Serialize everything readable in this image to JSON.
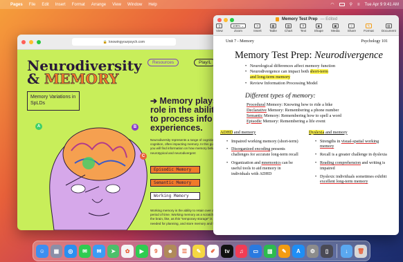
{
  "menubar": {
    "apple": "",
    "app_name": "Pages",
    "items": [
      "File",
      "Edit",
      "Insert",
      "Format",
      "Arrange",
      "View",
      "Window",
      "Help"
    ],
    "clock": "Tue Apr 9  9:41 AM"
  },
  "safari": {
    "url": "knowingyourpsych.com",
    "title_line1": "Neurodiversity",
    "title_line2_prefix": "& ",
    "title_line2": "MEMORY",
    "tab_resources": "Resources",
    "tab_play": "Play/L",
    "card_text": "Memory Variations in SpLDs",
    "headline": "Memory plays a role in the ability to process info experiences.",
    "arrow": "➔",
    "body_text": "Neurodiversity represents a range of cognitive and cognition, often impacting memory. In this guide, you will find information on how memory between neurotypical and neurodivergent",
    "buttons": [
      "Episodic Memory",
      "Semantic Memory",
      "Working Memory"
    ],
    "body_text2": "Working memory is the ability to retain over a short period of time. Working memory as a scratchpad for the brain, like, as this \"temporary storage\" is needed for planning, and store memory and focus.",
    "badges": [
      "A",
      "B",
      "C"
    ]
  },
  "pages": {
    "doc_title": "Memory Test Prep",
    "edited": "— Edited",
    "toolbar": [
      {
        "label": "View",
        "icon": "sidebar-icon"
      },
      {
        "label": "Zoom",
        "icon": "zoom-icon",
        "value": "106%"
      },
      {
        "label": "Insert",
        "icon": "plus-icon"
      },
      {
        "label": "Table",
        "icon": "table-icon"
      },
      {
        "label": "Chart",
        "icon": "chart-icon"
      },
      {
        "label": "Text",
        "icon": "text-icon"
      },
      {
        "label": "Shape",
        "icon": "shape-icon"
      },
      {
        "label": "Media",
        "icon": "media-icon"
      },
      {
        "label": "Share",
        "icon": "share-icon"
      },
      {
        "label": "Format",
        "icon": "format-icon"
      },
      {
        "label": "Document",
        "icon": "document-icon"
      }
    ],
    "header_left": "Unit 7 - Memory",
    "header_right": "Psychology 101",
    "heading_plain": "Memory Test Prep: ",
    "heading_italic": "Neurodivergence",
    "bullets": {
      "b1": "Neurological differences affect memory function",
      "b2_pre": "Neurodivergence can impact both ",
      "b2_hl1": "short-term",
      "b2_hl2": "and long-term memory",
      "b3": "Review Information Processing Model"
    },
    "subheading": "Different types of memory:",
    "types": [
      {
        "term": "Procedural",
        "rest": " Memory: Knowing how to ride a bike"
      },
      {
        "term": "Declarative",
        "rest": " Memory: Remembering a phone number"
      },
      {
        "term": "Semantic",
        "rest": " Memory: Remembering how to spell a word"
      },
      {
        "term": "Episodic",
        "rest": " Memory: Remembering a life event"
      }
    ],
    "col1": {
      "heading_hl": "ADHD",
      "heading_rest": " and memory",
      "items": {
        "i1": "Impaired working memory (short-term)",
        "i2_ul": "Disorganized encoding",
        "i2_rest": " presents challenges for accurate long-term recall",
        "i3_pre": "Organization and ",
        "i3_ul": "mnemonics",
        "i3_rest": " can be useful tools to aid memory in individuals with ADHD"
      }
    },
    "col2": {
      "heading_hl": "Dyslexia",
      "heading_rest": " and memory",
      "items": {
        "i1_pre": "Strengths in ",
        "i1_ul": "visual-spatial working memory",
        "i2": "Recall is a greater challenge in dyslexia",
        "i3_ul": "Reading comprehension",
        "i3_rest": " and writing is impaired",
        "i4_pre": "Dyslexic individuals sometimes exhibit ",
        "i4_ul": "excellent long-term memory"
      }
    }
  },
  "dock": {
    "apps": [
      {
        "name": "finder-icon",
        "color": "#3d8ef0",
        "glyph": "☺"
      },
      {
        "name": "launchpad-icon",
        "color": "#8a8fa8",
        "glyph": "▦"
      },
      {
        "name": "safari-icon",
        "color": "#2a8ff0",
        "glyph": "◎"
      },
      {
        "name": "messages-icon",
        "color": "#2ecc50",
        "glyph": "✉"
      },
      {
        "name": "mail-icon",
        "color": "#3a9cf5",
        "glyph": "✉"
      },
      {
        "name": "maps-icon",
        "color": "#4cbf6a",
        "glyph": "➤"
      },
      {
        "name": "photos-icon",
        "color": "#f5f5f5",
        "glyph": "✿"
      },
      {
        "name": "facetime-icon",
        "color": "#2ecc50",
        "glyph": "▶"
      },
      {
        "name": "calendar-icon",
        "color": "#ffffff",
        "glyph": "9"
      },
      {
        "name": "contacts-icon",
        "color": "#b08a5a",
        "glyph": "☻"
      },
      {
        "name": "reminders-icon",
        "color": "#ffffff",
        "glyph": "☰"
      },
      {
        "name": "notes-icon",
        "color": "#f5d742",
        "glyph": "✎"
      },
      {
        "name": "freeform-icon",
        "color": "#ffffff",
        "glyph": "✐"
      },
      {
        "name": "tv-icon",
        "color": "#111111",
        "glyph": "tv"
      },
      {
        "name": "music-icon",
        "color": "#f23c55",
        "glyph": "♫"
      },
      {
        "name": "keynote-icon",
        "color": "#2a7ae0",
        "glyph": "▭"
      },
      {
        "name": "numbers-icon",
        "color": "#2dbb4e",
        "glyph": "▥"
      },
      {
        "name": "pages-icon",
        "color": "#f39c12",
        "glyph": "✎"
      },
      {
        "name": "app-store-icon",
        "color": "#1e8ef5",
        "glyph": "A"
      },
      {
        "name": "system-settings-icon",
        "color": "#8c8c8c",
        "glyph": "⚙"
      },
      {
        "name": "iphone-mirroring-icon",
        "color": "#4a4a55",
        "glyph": "▯"
      }
    ],
    "right": [
      {
        "name": "downloads-folder-icon",
        "color": "#5aa8f0",
        "glyph": "↓"
      },
      {
        "name": "trash-icon",
        "color": "#d8d8d8",
        "glyph": "🗑"
      }
    ]
  }
}
